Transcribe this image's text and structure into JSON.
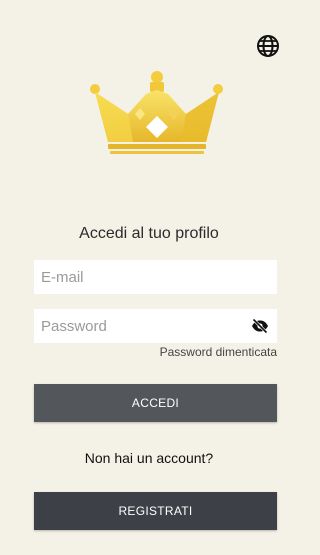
{
  "header": {
    "language_icon": "globe-icon"
  },
  "logo": {
    "icon": "crown-icon",
    "colors": {
      "gold_light": "#f7dc52",
      "gold_dark": "#e2b425",
      "gold_mid": "#f0c83a"
    }
  },
  "login": {
    "title": "Accedi al tuo profilo",
    "email_placeholder": "E-mail",
    "email_value": "",
    "password_placeholder": "Password",
    "password_value": "",
    "password_toggle_icon": "eye-off-icon",
    "forgot_password": "Password dimenticata",
    "submit_label": "ACCEDI"
  },
  "register": {
    "prompt": "Non hai un account?",
    "button_label": "REGISTRATI"
  },
  "colors": {
    "background": "#f4f1e6",
    "primary_button": "#53565b",
    "secondary_button": "#3d4047"
  }
}
